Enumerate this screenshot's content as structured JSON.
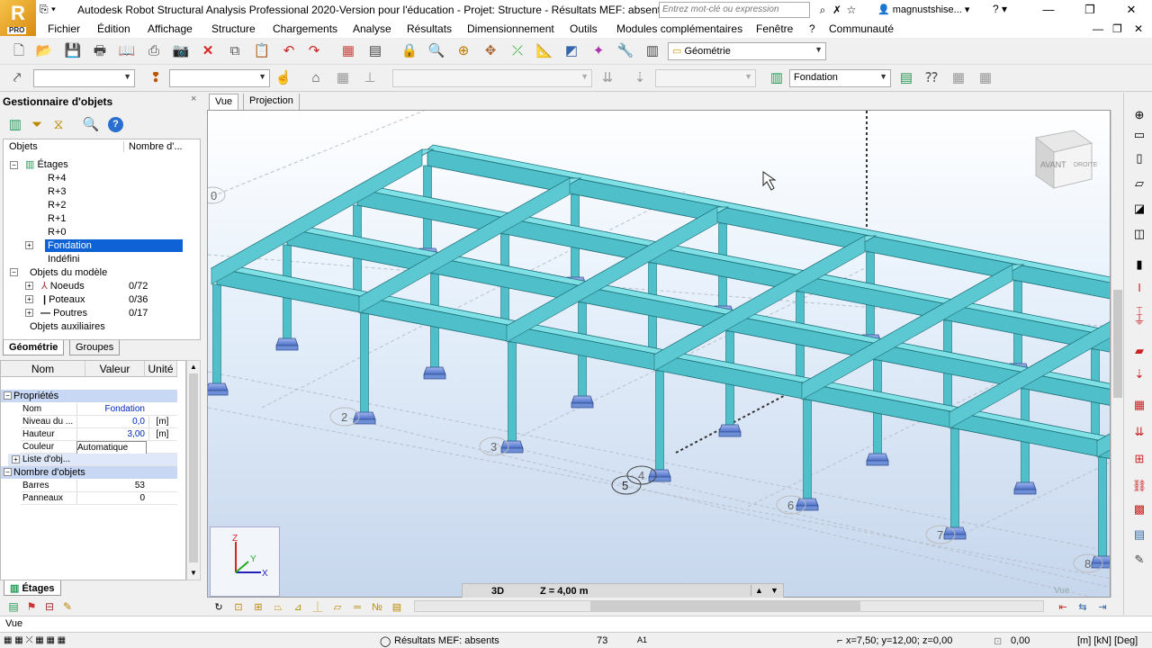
{
  "app": {
    "logo_text": "R",
    "logo_badge": "PRO",
    "title": "Autodesk Robot Structural Analysis Professional 2020-Version pour l'éducation - Projet: Structure - Résultats MEF: absents",
    "search_placeholder": "Entrez mot-clé ou expression",
    "user": "magnustshise... ▾",
    "help": "? ▾",
    "window_buttons": [
      "—",
      "❐",
      "✕"
    ]
  },
  "menu": [
    "Fichier",
    "Édition",
    "Affichage",
    "Structure",
    "Chargements",
    "Analyse",
    "Résultats",
    "Dimensionnement",
    "Outils",
    "Modules complémentaires",
    "Fenêtre",
    "?",
    "Communauté"
  ],
  "menu_right": [
    "—",
    "❐",
    "✕"
  ],
  "toolbar1": {
    "layout_combo": "Géométrie"
  },
  "toolbar2": {
    "combo1": "",
    "combo2": "",
    "combo3": "",
    "combo4": "",
    "story_combo": "Fondation"
  },
  "object_manager": {
    "title": "Gestionnaire d'objets",
    "close": "×",
    "columns": [
      "Objets",
      "Nombre d'..."
    ],
    "tree": {
      "etages": "Étages",
      "levels": [
        "R+4",
        "R+3",
        "R+2",
        "R+1",
        "R+0",
        "Fondation",
        "Indéfini"
      ],
      "model_objects": "Objets du modèle",
      "nodes": {
        "label": "Noeuds",
        "count": "0/72"
      },
      "columns_obj": {
        "label": "Poteaux",
        "count": "0/36"
      },
      "beams": {
        "label": "Poutres",
        "count": "0/17"
      },
      "aux": "Objets auxiliaires"
    },
    "tabs": [
      "Géométrie",
      "Groupes"
    ]
  },
  "properties": {
    "headers": [
      "Nom",
      "Valeur",
      "Unité"
    ],
    "section_props": "Propriétés",
    "rows": [
      {
        "name": "Nom",
        "value": "Fondation",
        "unit": ""
      },
      {
        "name": "Niveau du ...",
        "value": "0,0",
        "unit": "[m]"
      },
      {
        "name": "Hauteur",
        "value": "3,00",
        "unit": "[m]"
      },
      {
        "name": "Couleur",
        "value": "Automatique",
        "unit": ""
      },
      {
        "name": "Liste d'obj...",
        "value": "",
        "unit": ""
      }
    ],
    "section_count": "Nombre d'objets",
    "count_rows": [
      {
        "name": "Barres",
        "value": "53"
      },
      {
        "name": "Panneaux",
        "value": "0"
      }
    ],
    "tab": "Étages"
  },
  "viewport": {
    "tabs": [
      "Vue",
      "Projection"
    ],
    "viewcube_label": "AVANT",
    "viewcube_side": "DROITE",
    "grid_labels": [
      "0",
      "2",
      "3",
      "4",
      "5",
      "6",
      "7",
      "8"
    ],
    "axis_labels": [
      "Z",
      "Y",
      "X"
    ],
    "mode": "3D",
    "z_level": "Z = 4,00 m",
    "corner_label": "Vue"
  },
  "bottom": {
    "view_field": "Vue",
    "status_text": "Résultats MEF: absents",
    "count": "73",
    "node": "A1",
    "coords": "x=7,50; y=12,00; z=0,00",
    "value": "0,00",
    "units": "[m] [kN] [Deg]"
  },
  "colors": {
    "beam_top": "#7fe0e6",
    "beam_side": "#4fbfc9",
    "beam_edge": "#1e6f78",
    "footing": "#6d8fd8",
    "selection": "#0f62d6",
    "section_bg": "#c8d8f4"
  }
}
